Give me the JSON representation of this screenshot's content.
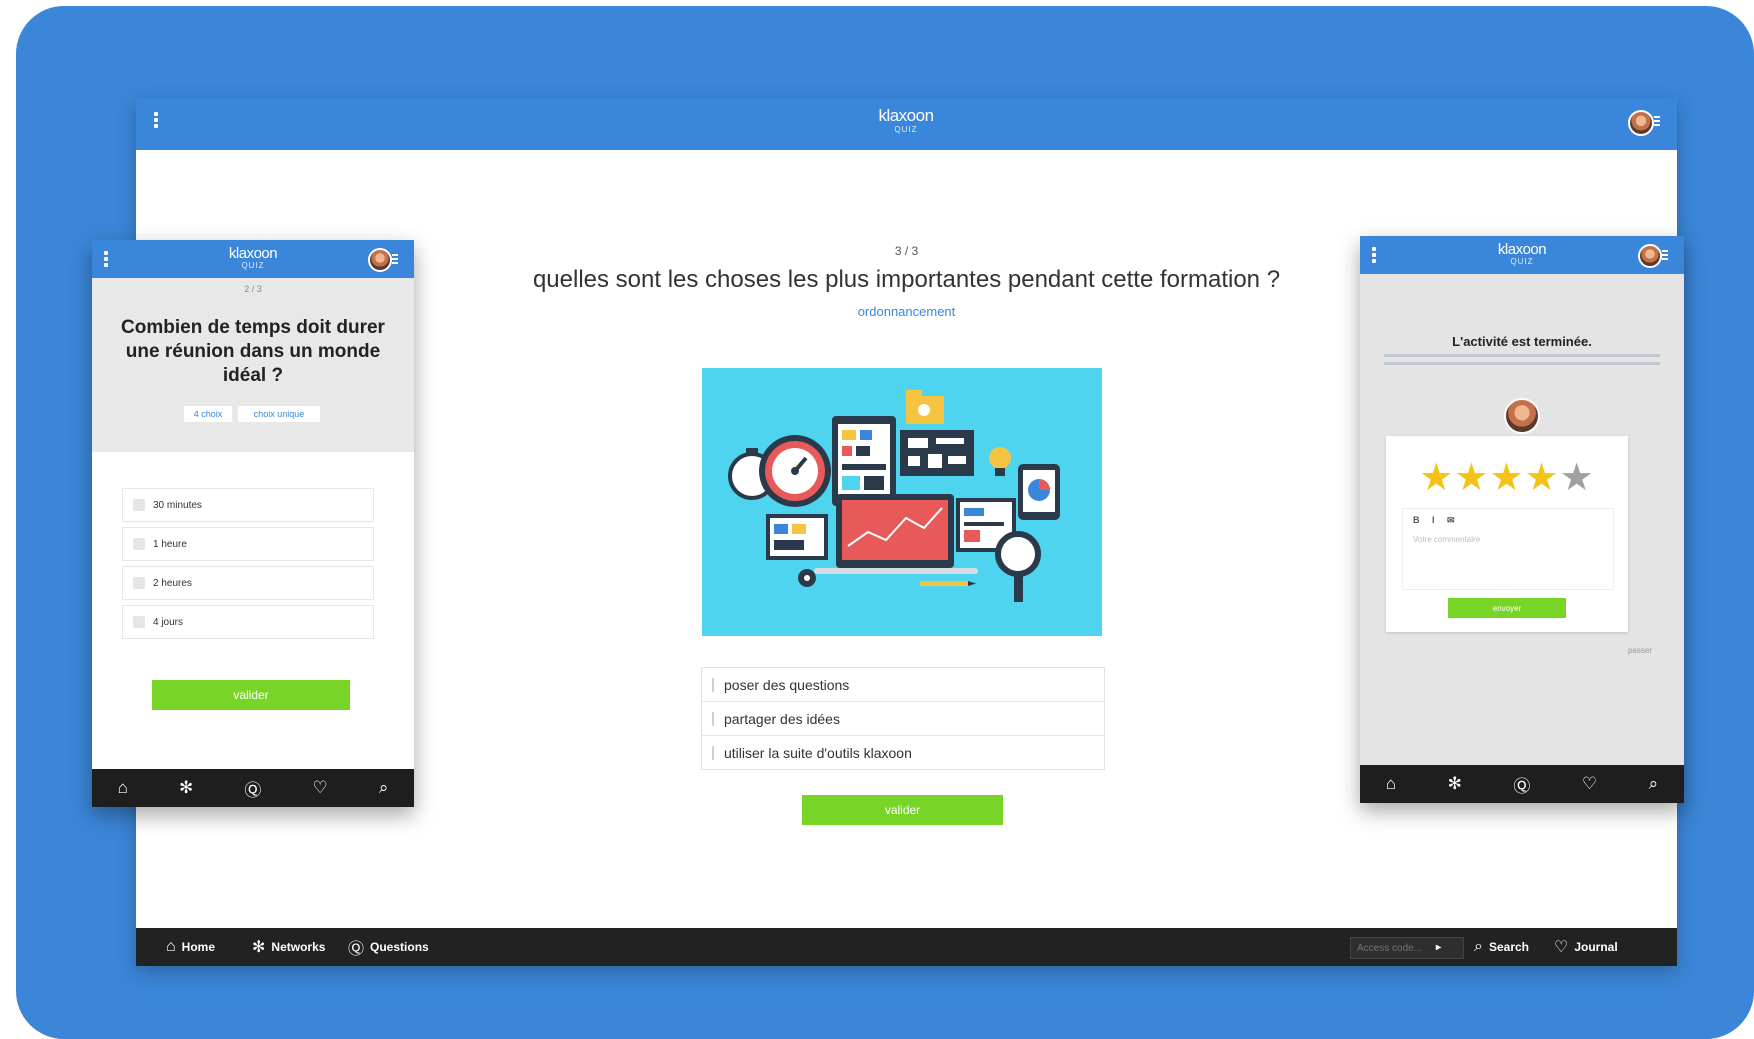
{
  "brand": {
    "name": "klaxoon",
    "sub": "QUIZ"
  },
  "main": {
    "counter": "3 / 3",
    "question": "quelles sont les choses les plus importantes pendant cette formation ?",
    "question_type": "ordonnancement",
    "answers": [
      "poser des questions",
      "partager des idées",
      "utiliser la suite d'outils klaxoon"
    ],
    "validate": "valider"
  },
  "bottom_nav": {
    "home": "Home",
    "networks": "Networks",
    "questions": "Questions",
    "code_placeholder": "Access code...",
    "search": "Search",
    "journal": "Journal"
  },
  "left_phone": {
    "counter": "2 / 3",
    "question": "Combien de temps doit durer une réunion dans un monde idéal ?",
    "chips": [
      "4 choix",
      "choix unique"
    ],
    "options": [
      "30 minutes",
      "1 heure",
      "2 heures",
      "4 jours"
    ],
    "validate": "valider"
  },
  "right_phone": {
    "title": "L'activité est terminée.",
    "rating": 4,
    "rating_max": 5,
    "editor_tools": "B I ✉",
    "editor_placeholder": "Votre commentaire",
    "send": "envoyer",
    "footer": "passer"
  },
  "colors": {
    "frame_blue": "#3b86d8",
    "header_blue": "#3a86da",
    "green": "#79d428",
    "dark_bar": "#222222",
    "illustration_bg": "#4ed4ef",
    "star": "#f2c418"
  }
}
